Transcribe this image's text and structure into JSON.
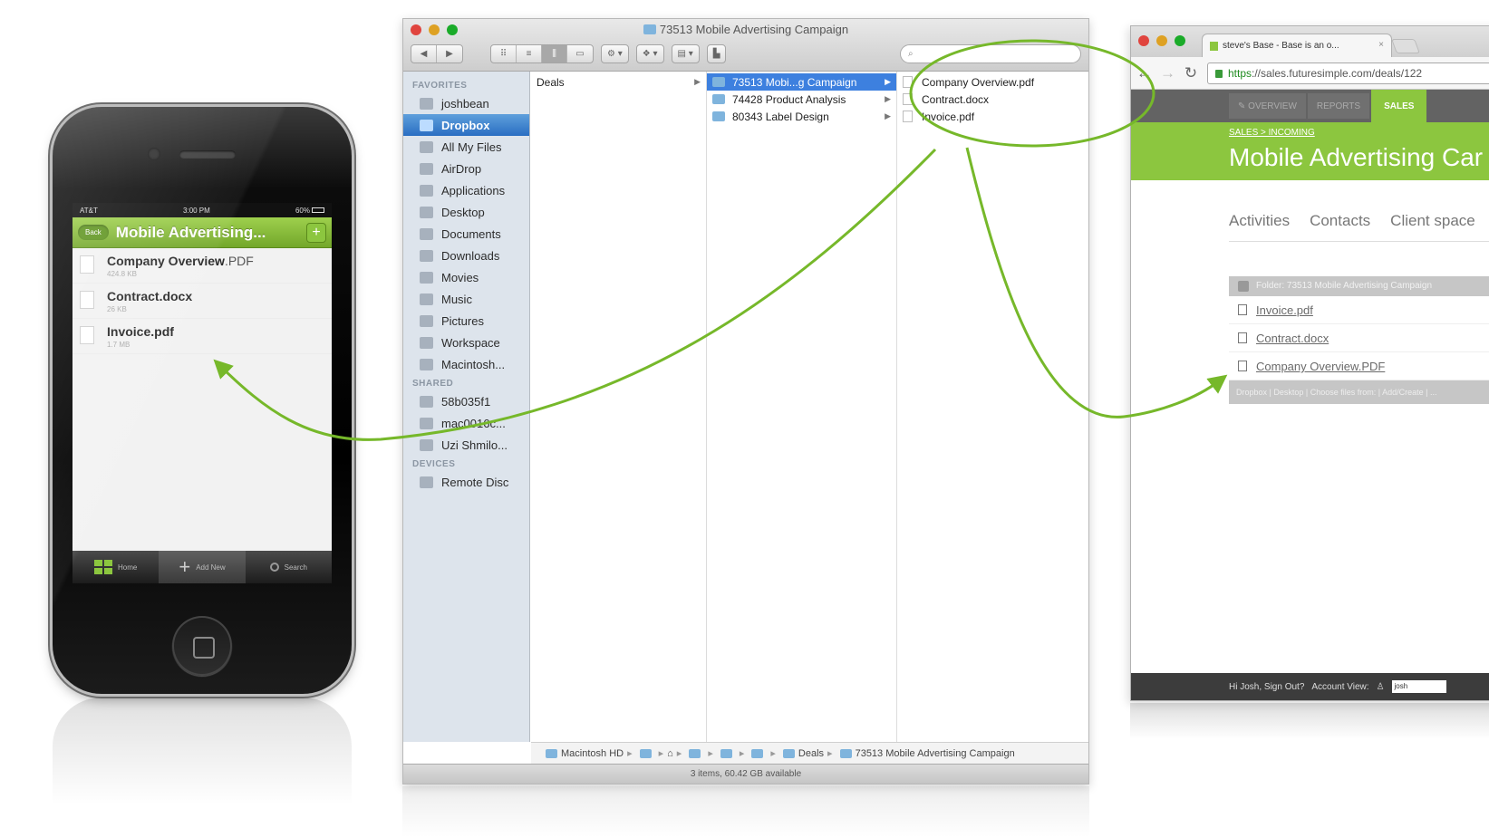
{
  "colors": {
    "accent_green": "#8cc63f",
    "finder_selection": "#3d80df",
    "annotation_green": "#76b82a"
  },
  "phone": {
    "status": {
      "carrier": "AT&T",
      "time": "3:00 PM",
      "battery": "60%"
    },
    "navbar": {
      "back_label": "Back",
      "title": "Mobile Advertising...",
      "add_icon": "plus-icon"
    },
    "files": [
      {
        "name": "Company Overview",
        "ext": ".PDF",
        "size": "424.8 KB"
      },
      {
        "name": "Contract",
        "ext": ".docx",
        "size": "26 KB"
      },
      {
        "name": "Invoice",
        "ext": ".pdf",
        "size": "1.7 MB"
      }
    ],
    "tabbar": {
      "home": "Home",
      "add": "Add New",
      "search": "Search"
    }
  },
  "finder": {
    "title": "73513 Mobile Advertising Campaign",
    "search_placeholder": "",
    "sidebar": {
      "favorites_header": "FAVORITES",
      "favorites": [
        "joshbean",
        "Dropbox",
        "All My Files",
        "AirDrop",
        "Applications",
        "Desktop",
        "Documents",
        "Downloads",
        "Movies",
        "Music",
        "Pictures",
        "Workspace",
        "Macintosh..."
      ],
      "shared_header": "SHARED",
      "shared": [
        "58b035f1",
        "mac0016c...",
        "Uzi Shmilo..."
      ],
      "devices_header": "DEVICES",
      "devices": [
        "Remote Disc"
      ]
    },
    "col1": [
      "Deals"
    ],
    "col2": [
      "73513 Mobi...g Campaign",
      "74428 Product Analysis",
      "80343 Label Design"
    ],
    "col3": [
      "Company Overview.pdf",
      "Contract.docx",
      "Invoice.pdf"
    ],
    "pathbar": {
      "hd": "Macintosh HD",
      "deals": "Deals",
      "current": "73513 Mobile Advertising Campaign"
    },
    "status": "3 items, 60.42 GB available"
  },
  "browser": {
    "tab_title": "steve's Base - Base is an o...",
    "url_scheme": "https",
    "url_rest": "://sales.futuresimple.com/deals/122",
    "nav": [
      "OVERVIEW",
      "REPORTS",
      "SALES"
    ],
    "breadcrumb": "SALES > INCOMING",
    "page_title": "Mobile Advertising Car",
    "subtabs": [
      "Activities",
      "Contacts",
      "Client space"
    ],
    "list_header": "Folder: 73513 Mobile Advertising Campaign",
    "documents": [
      "Invoice.pdf",
      "Contract.docx",
      "Company Overview.PDF"
    ],
    "list_footer": "Dropbox | Desktop | Choose files from: | Add/Create | ...",
    "footer": {
      "greeting": "Hi Josh, Sign Out?",
      "account_view": "Account View:",
      "user": "josh"
    }
  }
}
